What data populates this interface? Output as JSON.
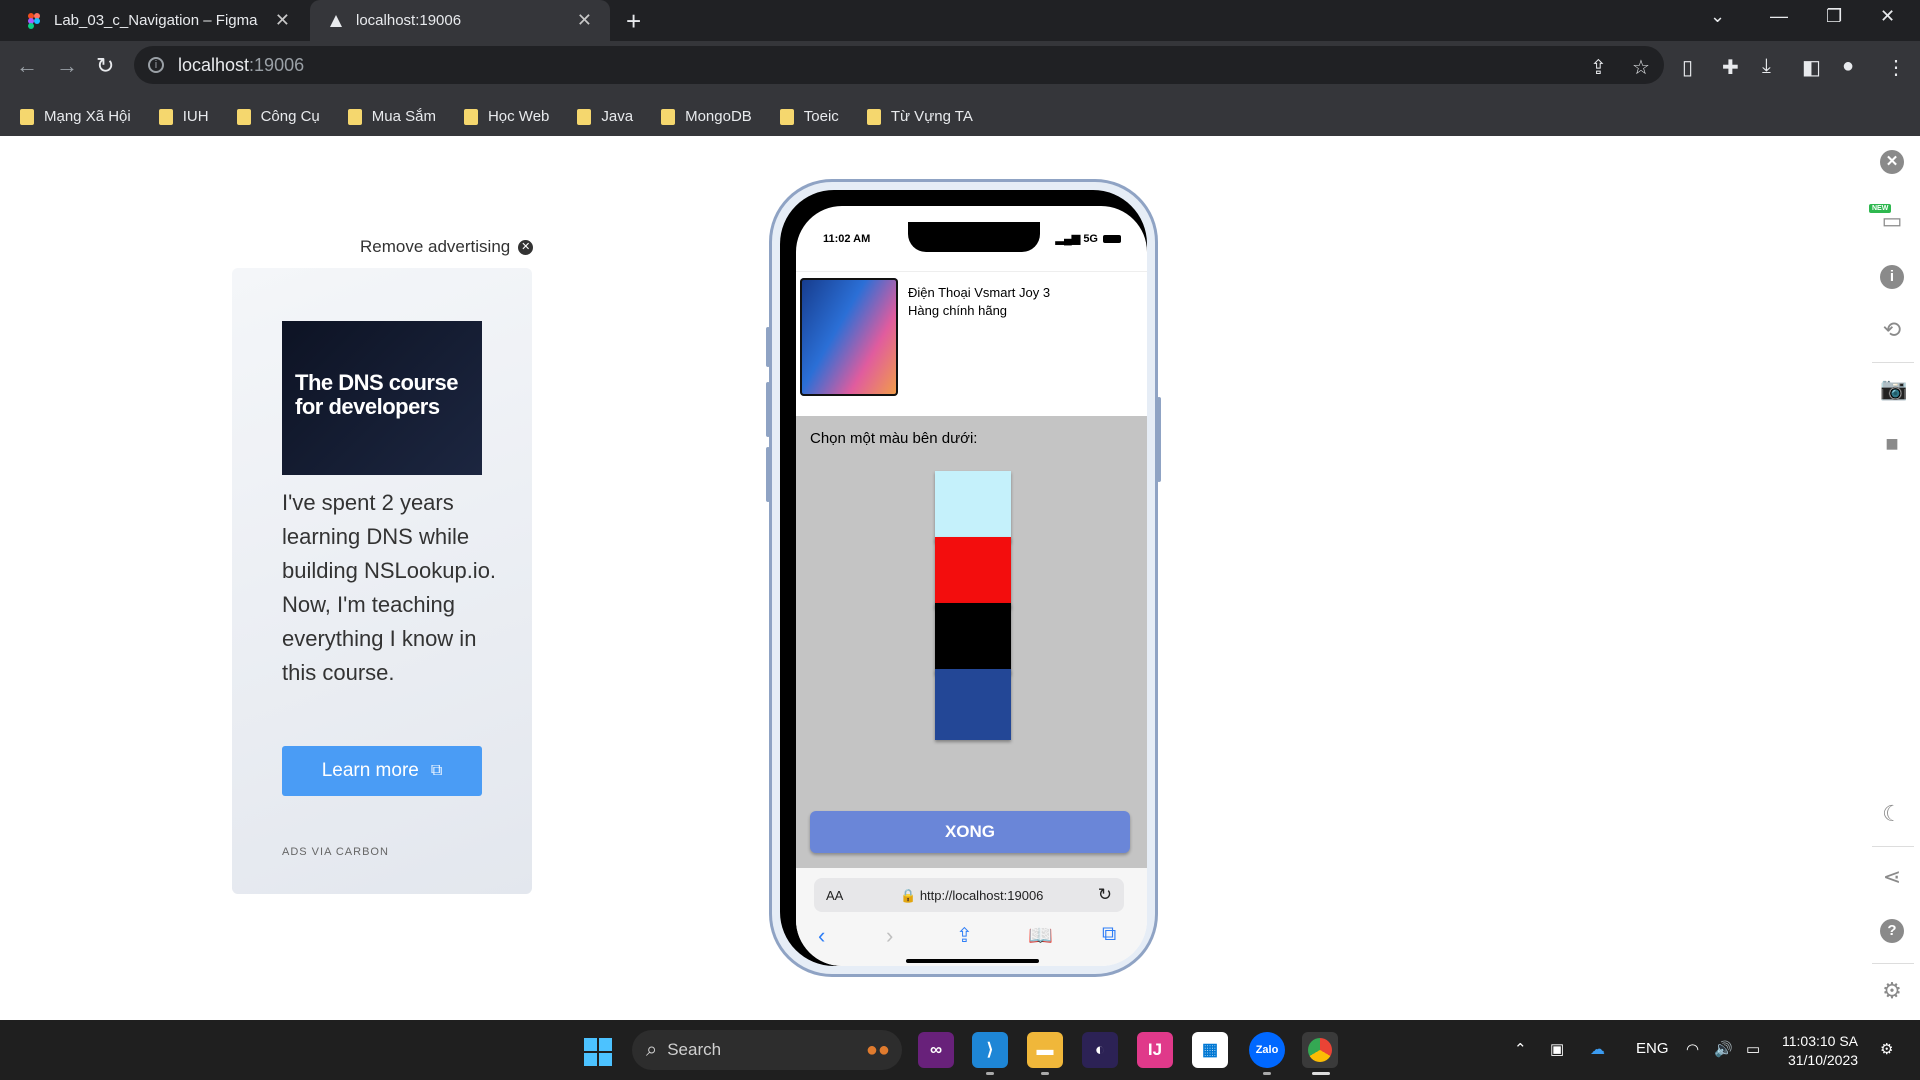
{
  "browser": {
    "tabs": [
      {
        "title": "Lab_03_c_Navigation – Figma",
        "active": false
      },
      {
        "title": "localhost:19006",
        "active": true
      }
    ],
    "address": {
      "host": "localhost",
      "port": ":19006"
    },
    "bookmarks": [
      "Mạng Xã Hội",
      "IUH",
      "Công Cụ",
      "Mua Sắm",
      "Học Web",
      "Java",
      "MongoDB",
      "Toeic",
      "Từ Vựng TA"
    ]
  },
  "ad": {
    "remove_label": "Remove advertising",
    "image_headline": "The DNS course for developers",
    "body": "I've spent 2 years learning DNS while building NSLookup.io. Now, I'm teaching everything I know in this course.",
    "button_label": "Learn more",
    "via_label": "ADS VIA CARBON"
  },
  "phone": {
    "status_time": "11:02 AM",
    "signal_label": "5G",
    "product": {
      "name_line1": "Điện Thoại Vsmart Joy 3",
      "name_line2": "Hàng chính hãng"
    },
    "choose_label": "Chọn một màu bên dưới:",
    "swatches": [
      {
        "name": "light-blue",
        "color": "#c5f1fb"
      },
      {
        "name": "red",
        "color": "#f30d0d"
      },
      {
        "name": "black",
        "color": "#000000"
      },
      {
        "name": "blue",
        "color": "#234796"
      }
    ],
    "done_button": "XONG",
    "safari": {
      "aa_label": "AA",
      "url": "http://localhost:19006"
    }
  },
  "taskbar": {
    "search_label": "Search",
    "language": "ENG",
    "time": "11:03:10 SA",
    "date": "31/10/2023"
  },
  "colors": {
    "accent": "#6a86d8",
    "color_area_bg": "#c4c4c4",
    "ad_button": "#4a9cf5"
  }
}
